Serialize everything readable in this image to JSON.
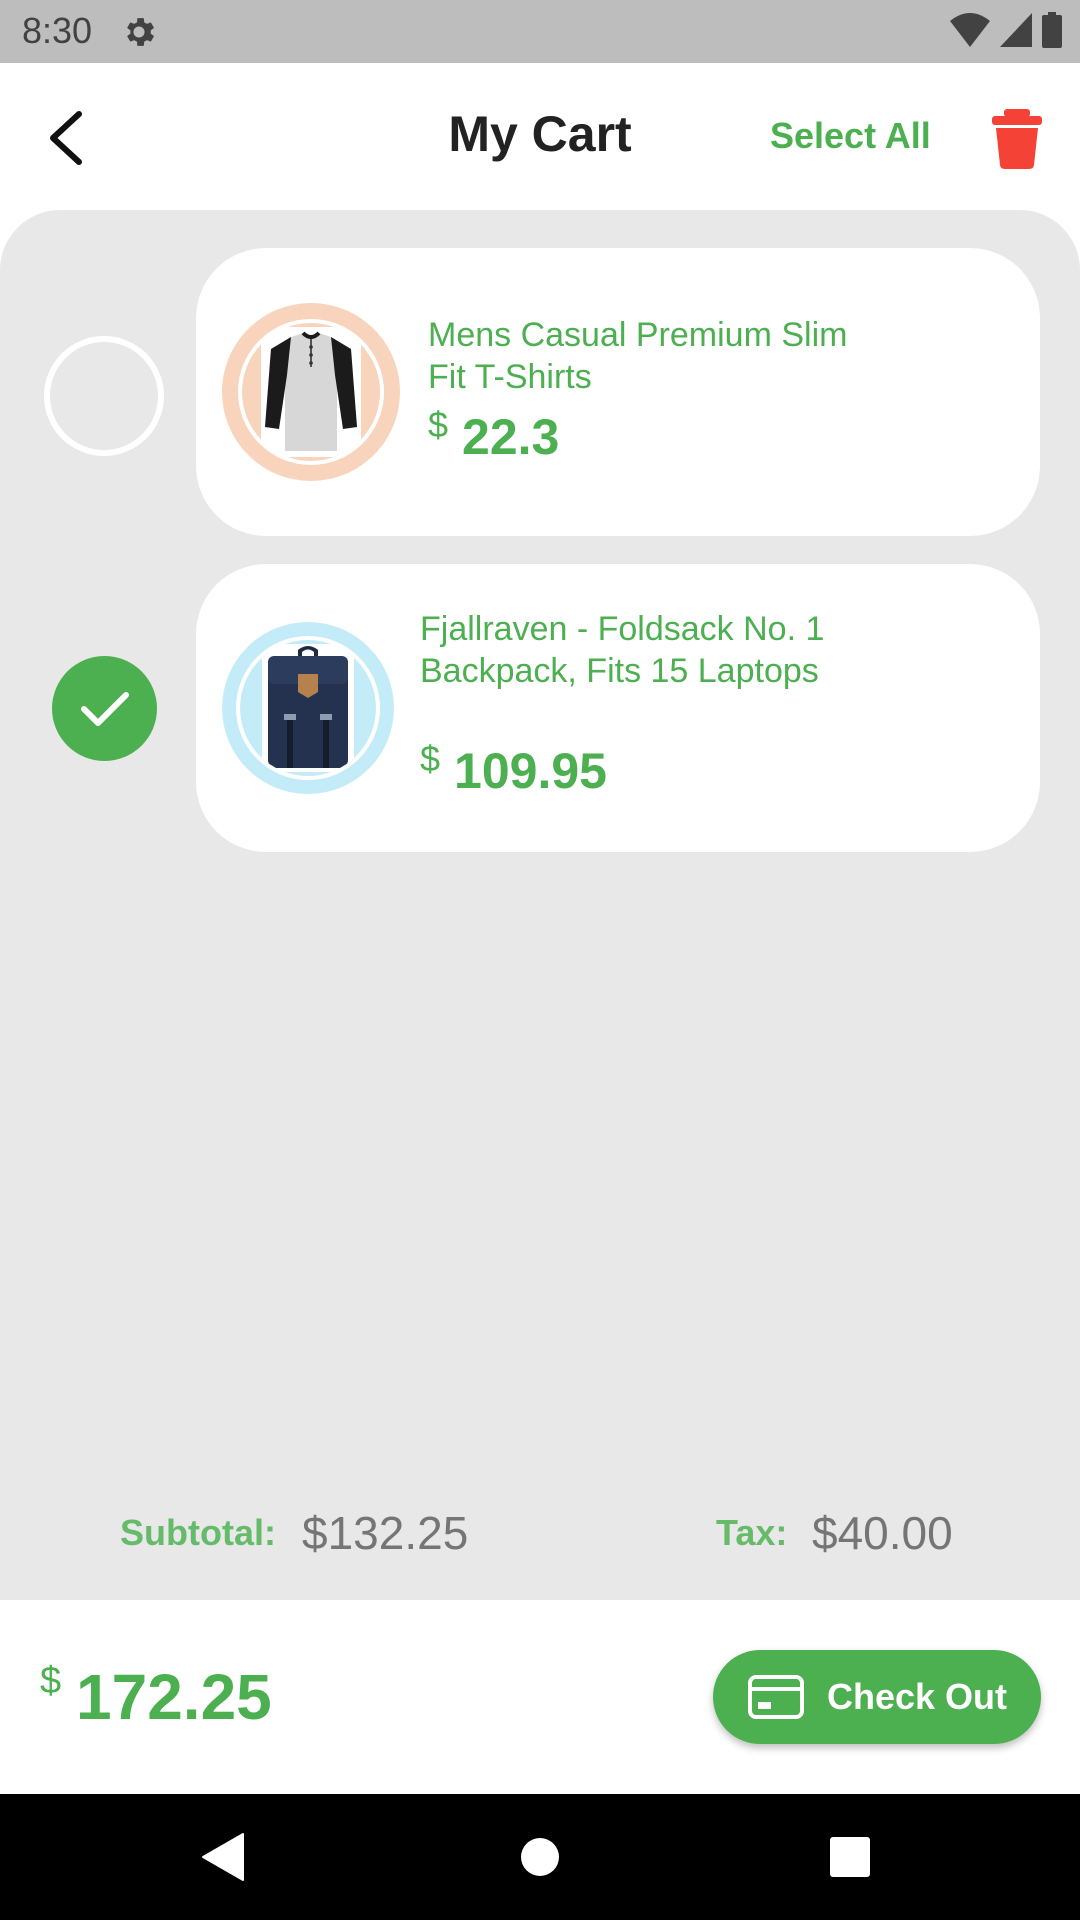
{
  "status_bar": {
    "time": "8:30"
  },
  "header": {
    "title": "My Cart",
    "select_all": "Select All"
  },
  "items": [
    {
      "name": "Mens Casual Premium Slim Fit T-Shirts",
      "currency": "$",
      "price": "22.3",
      "selected": false,
      "ring_color": "#f9d4bd"
    },
    {
      "name": "Fjallraven - Foldsack No. 1 Backpack, Fits 15 Laptops",
      "currency": "$",
      "price": "109.95",
      "selected": true,
      "ring_color": "#c4ecf8"
    }
  ],
  "totals": {
    "subtotal_label": "Subtotal:",
    "subtotal_value": "$132.25",
    "tax_label": "Tax:",
    "tax_value": "$40.00",
    "total_currency": "$",
    "total_value": "172.25"
  },
  "checkout": {
    "label": "Check Out"
  },
  "colors": {
    "accent": "#4caf50",
    "danger": "#f44336"
  }
}
